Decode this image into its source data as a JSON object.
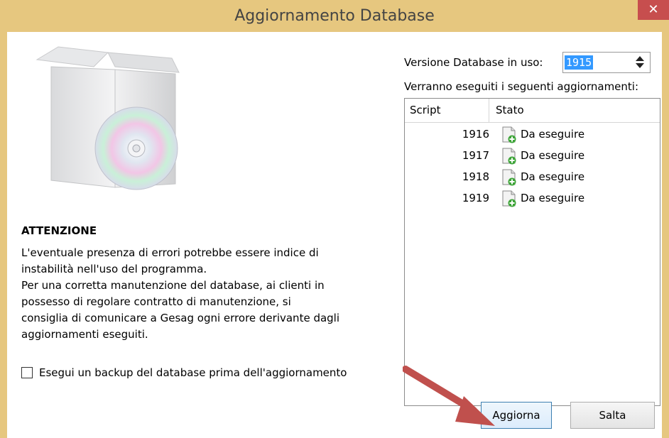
{
  "window": {
    "title": "Aggiornamento Database",
    "close_glyph": "✕"
  },
  "warning": {
    "title": "ATTENZIONE",
    "lines": [
      "L'eventuale presenza di errori potrebbe essere indice di",
      "instabilità nell'uso del programma.",
      "Per una corretta manutenzione del database, ai clienti in",
      "possesso di regolare contratto di manutenzione, si",
      "consiglia di comunicare a Gesag ogni errore derivante dagli",
      "aggiornamenti eseguiti."
    ]
  },
  "backup": {
    "label": "Esegui un backup del database prima dell'aggiornamento",
    "checked": false
  },
  "version": {
    "label": "Versione Database in uso:",
    "value": "1915"
  },
  "updates": {
    "label": "Verranno eseguiti i seguenti aggiornamenti:",
    "columns": {
      "script": "Script",
      "status": "Stato"
    },
    "rows": [
      {
        "script": "1916",
        "status": "Da eseguire",
        "icon": "document-add-icon"
      },
      {
        "script": "1917",
        "status": "Da eseguire",
        "icon": "document-add-icon"
      },
      {
        "script": "1918",
        "status": "Da eseguire",
        "icon": "document-add-icon"
      },
      {
        "script": "1919",
        "status": "Da eseguire",
        "icon": "document-add-icon"
      }
    ]
  },
  "buttons": {
    "update": "Aggiorna",
    "skip": "Salta"
  },
  "colors": {
    "titlebar": "#e6c77f",
    "close": "#c74e4e",
    "selection": "#3399ff",
    "arrow": "#c0504d"
  },
  "icons": {
    "box": "software-box-icon",
    "arrow": "red-pointer-arrow"
  }
}
